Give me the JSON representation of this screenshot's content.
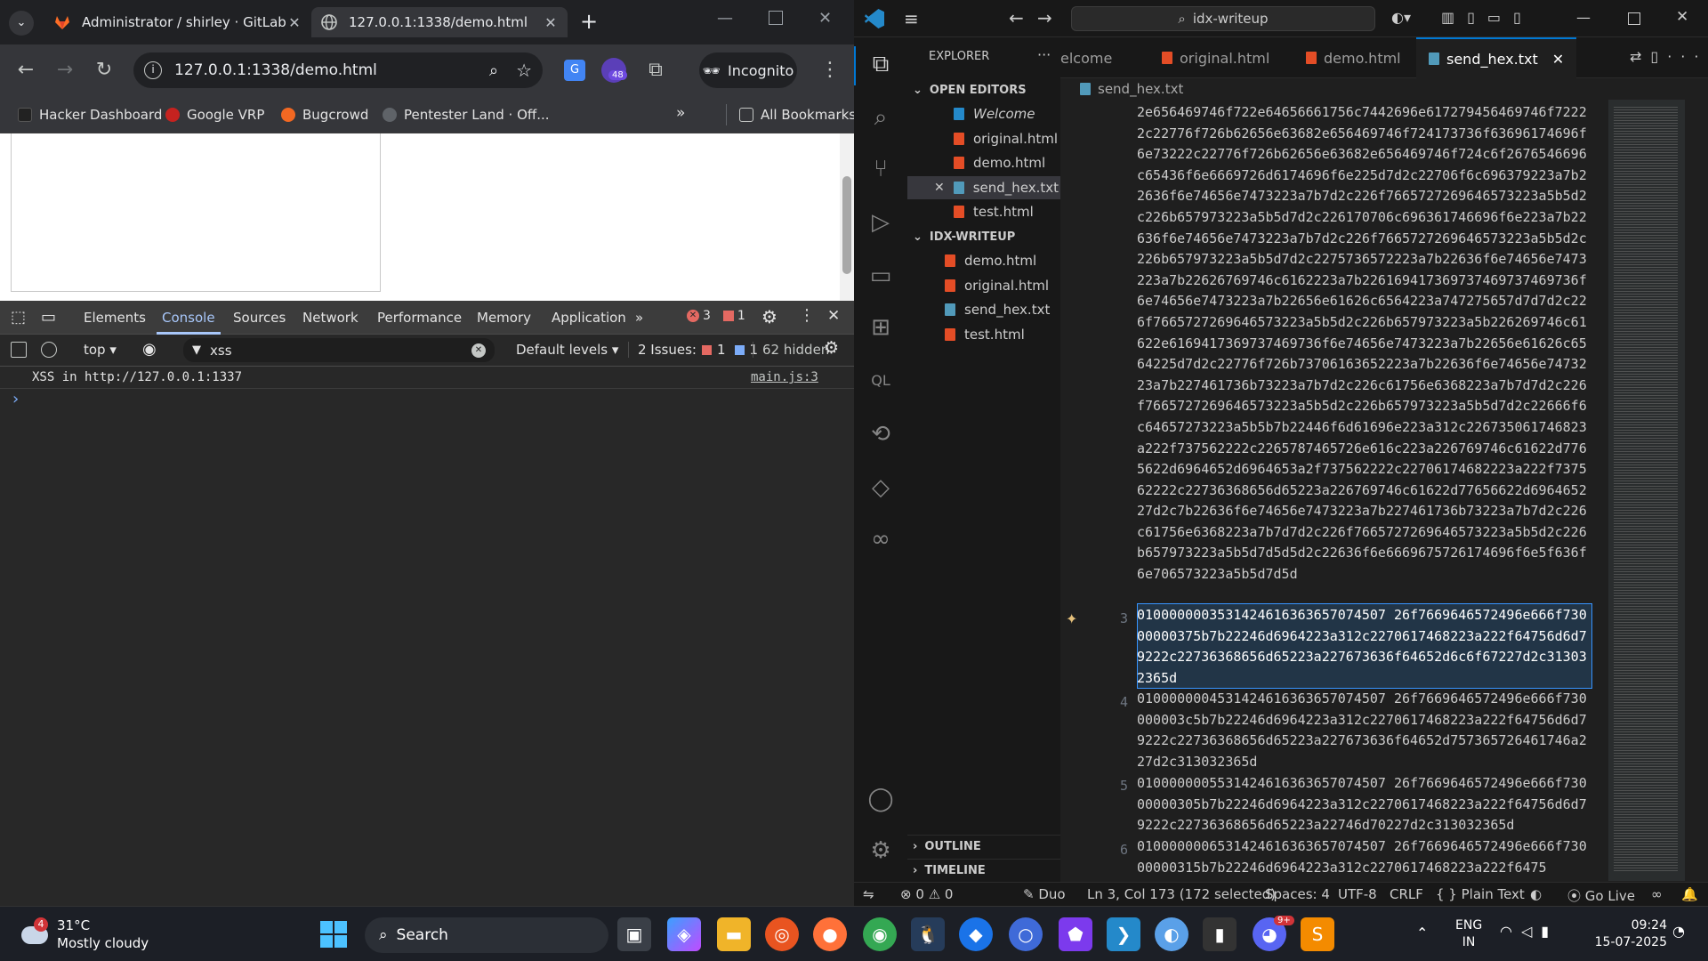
{
  "chrome": {
    "tabs": [
      {
        "title": "Administrator / shirley · GitLab",
        "active": false
      },
      {
        "title": "127.0.0.1:1338/demo.html",
        "active": true
      }
    ],
    "url": "127.0.0.1:1338/demo.html",
    "extension_badge": "48",
    "incognito_label": "Incognito",
    "bookmarks": [
      "Hacker Dashboard",
      "Google VRP",
      "Bugcrowd",
      "Pentester Land · Off..."
    ],
    "all_bookmarks": "All Bookmarks"
  },
  "devtools": {
    "tabs": [
      "Elements",
      "Console",
      "Sources",
      "Network",
      "Performance",
      "Memory",
      "Application"
    ],
    "active_tab": "Console",
    "error_count": "3",
    "warning_count": "1",
    "context": "top",
    "filter_value": "xss",
    "levels": "Default levels",
    "issues_label": "2 Issues:",
    "issues_errors": "1",
    "issues_info": "1",
    "hidden": "62 hidden",
    "console_message": "XSS in http://127.0.0.1:1337",
    "console_source": "main.js:3",
    "prompt": "›"
  },
  "vscode": {
    "search": "idx-writeup",
    "explorer_title": "EXPLORER",
    "open_editors_title": "OPEN EDITORS",
    "open_editors": [
      {
        "name": "Welcome",
        "type": "vscode"
      },
      {
        "name": "original.html",
        "type": "html"
      },
      {
        "name": "demo.html",
        "type": "html"
      },
      {
        "name": "send_hex.txt",
        "type": "txt"
      },
      {
        "name": "test.html",
        "type": "html"
      }
    ],
    "folder_title": "IDX-WRITEUP",
    "folder_files": [
      {
        "name": "demo.html",
        "type": "html"
      },
      {
        "name": "original.html",
        "type": "html"
      },
      {
        "name": "send_hex.txt",
        "type": "txt"
      },
      {
        "name": "test.html",
        "type": "html"
      }
    ],
    "outline": "OUTLINE",
    "timeline": "TIMELINE",
    "editor_tabs": [
      {
        "name": "elcome",
        "type": "vscode",
        "active": false
      },
      {
        "name": "original.html",
        "type": "html",
        "active": false
      },
      {
        "name": "demo.html",
        "type": "html",
        "active": false
      },
      {
        "name": "send_hex.txt",
        "type": "txt",
        "active": true
      }
    ],
    "breadcrumb": "send_hex.txt",
    "code_lines": [
      {
        "num": "",
        "text": "2e656469746f722e64656661756c7442696e617279456469746f72222c22776f726b62656e63682e656469746f724173736f63696174696f6e73222c22776f726b62656e63682e656469746f724c6f2676546696c65436f6e6669726d6174696f6e225d7d2c22706f6c696379223a7b22636f6e74656e7473223a7b7d2c226f7665727269646573223a5b5d2c226b657973223a5b5d7d2c226170706c696361746696f6e223a7b22636f6e74656e7473223a7b7d2c226f7665727269646573223a5b5d2c226b657973223a5b5d7d2c2275736572223a7b22636f6e74656e7473223a7b22626769746c6162223a7b226169417369737469737469736f6e74656e7473223a7b22656e61626c6564223a747275657d7d7d2c226f7665727269646573223a5b5d2c226b657973223a5b226269746c61622e6169417369737469736f6e74656e7473223a7b22656e61626c6564225d7d2c22776f726b73706163652223a7b22636f6e74656e7473223a7b227461736b73223a7b7d2c226c61756e6368223a7b7d7d2c226f7665727269646573223a5b5d2c226b657973223a5b5d7d2c22666f6c64657273223a5b5b7b22446f6d61696e223a312c226735061746823a222f737562222c2265787465726e616c223a226769746c61622d7765622d6964652d6964653a2f737562222c22706174682223a222f737562222c22736368656d65223a226769746c61622d77656622d696465227d2c7b22636f6e74656e7473223a7b227461736b73223a7b7d2c226c61756e6368223a7b7d7d2c226f7665727269646573223a5b5d2c226b657973223a5b5d7d5d5d2c22636f6e6669675726174696f6e5f636f6e706573223a5b5d7d5d"
      },
      {
        "num": "3",
        "text": "0100000003531424616363657074507 26f7669646572496e666f73000000375b7b22246d6964223a312c2270617468223a222f64756d6d79222c22736368656d65223a227673636f64652d6c6f67227d2c313032365d"
      },
      {
        "num": "4",
        "text": "0100000004531424616363657074507 26f7669646572496e666f730000003c5b7b22246d6964223a312c2270617468223a222f64756d6d79222c22736368656d65223a227673636f64652d757365726461746a227d2c313032365d"
      },
      {
        "num": "5",
        "text": "0100000005531424616363657074507 26f7669646572496e666f73000000305b7b22246d6964223a312c2270617468223a222f64756d6d79222c22736368656d65223a22746d70227d2c313032365d"
      },
      {
        "num": "6",
        "text": "0100000006531424616363657074507 26f7669646572496e666f73000000315b7b22246d6964223a312c2270617468223a222f6475"
      }
    ],
    "status": {
      "errors": "0",
      "warnings": "0",
      "theme": "Duo",
      "position": "Ln 3, Col 173 (172 selected)",
      "spaces": "Spaces: 4",
      "encoding": "UTF-8",
      "eol": "CRLF",
      "language": "Plain Text",
      "golive": "Go Live"
    }
  },
  "taskbar": {
    "weather_badge": "4",
    "temperature": "31°C",
    "weather": "Mostly cloudy",
    "search": "Search",
    "lang1": "ENG",
    "lang2": "IN",
    "time": "09:24",
    "date": "15-07-2025",
    "discord_badge": "9+"
  },
  "colors": {
    "chrome_bg": "#202124",
    "vscode_bg": "#1f1f1f",
    "accent": "#0078d4",
    "html_icon": "#e44d26",
    "txt_icon": "#519aba",
    "selection": "#264f78"
  }
}
